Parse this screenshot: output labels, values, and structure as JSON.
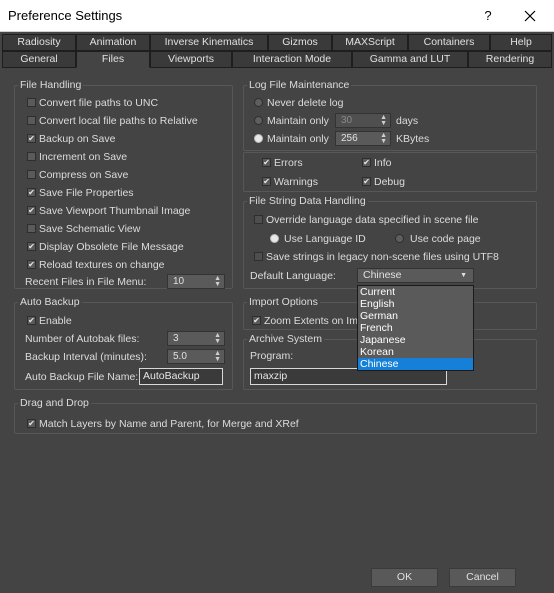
{
  "window": {
    "title": "Preference Settings",
    "help_label": "?"
  },
  "tabs_row1": [
    "Radiosity",
    "Animation",
    "Inverse Kinematics",
    "Gizmos",
    "MAXScript",
    "Containers",
    "Help"
  ],
  "tabs_row2": [
    "General",
    "Files",
    "Viewports",
    "Interaction Mode",
    "Gamma and LUT",
    "Rendering"
  ],
  "file_handling": {
    "title": "File Handling",
    "items": [
      {
        "label": "Convert file paths to UNC",
        "checked": false
      },
      {
        "label": "Convert local file paths to Relative",
        "checked": false
      },
      {
        "label": "Backup on Save",
        "checked": true
      },
      {
        "label": "Increment on Save",
        "checked": false
      },
      {
        "label": "Compress on Save",
        "checked": false
      },
      {
        "label": "Save File Properties",
        "checked": true
      },
      {
        "label": "Save Viewport Thumbnail Image",
        "checked": true
      },
      {
        "label": "Save Schematic View",
        "checked": false
      },
      {
        "label": "Display Obsolete File Message",
        "checked": true
      },
      {
        "label": "Reload textures on change",
        "checked": true
      }
    ],
    "recent_label": "Recent Files in File Menu:",
    "recent_value": "10"
  },
  "auto_backup": {
    "title": "Auto Backup",
    "enable_label": "Enable",
    "num_label": "Number of Autobak files:",
    "num_value": "3",
    "interval_label": "Backup Interval (minutes):",
    "interval_value": "5.0",
    "name_label": "Auto Backup File Name:",
    "name_value": "AutoBackup"
  },
  "log": {
    "title": "Log File Maintenance",
    "never_label": "Never delete log",
    "only_label": "Maintain only",
    "days_value": "30",
    "days_unit": "days",
    "kb_value": "256",
    "kb_unit": "KBytes",
    "errors_label": "Errors",
    "info_label": "Info",
    "warnings_label": "Warnings",
    "debug_label": "Debug"
  },
  "string_data": {
    "title": "File String Data Handling",
    "override_label": "Override language data specified in scene file",
    "use_lang_id": "Use Language ID",
    "use_code_page": "Use code page",
    "save_utf8_label": "Save strings in legacy non-scene files using UTF8",
    "default_lang_label": "Default Language:",
    "default_lang_value": "Chinese",
    "options": [
      "Current",
      "English",
      "German",
      "French",
      "Japanese",
      "Korean",
      "Chinese"
    ]
  },
  "import": {
    "title": "Import Options",
    "zoom_label": "Zoom Extents on Imp"
  },
  "archive": {
    "title": "Archive System",
    "program_label": "Program:",
    "program_value": "maxzip"
  },
  "drag_drop": {
    "title": "Drag and Drop",
    "match_label": "Match Layers by Name and Parent, for Merge and XRef"
  },
  "buttons": {
    "ok": "OK",
    "cancel": "Cancel"
  }
}
